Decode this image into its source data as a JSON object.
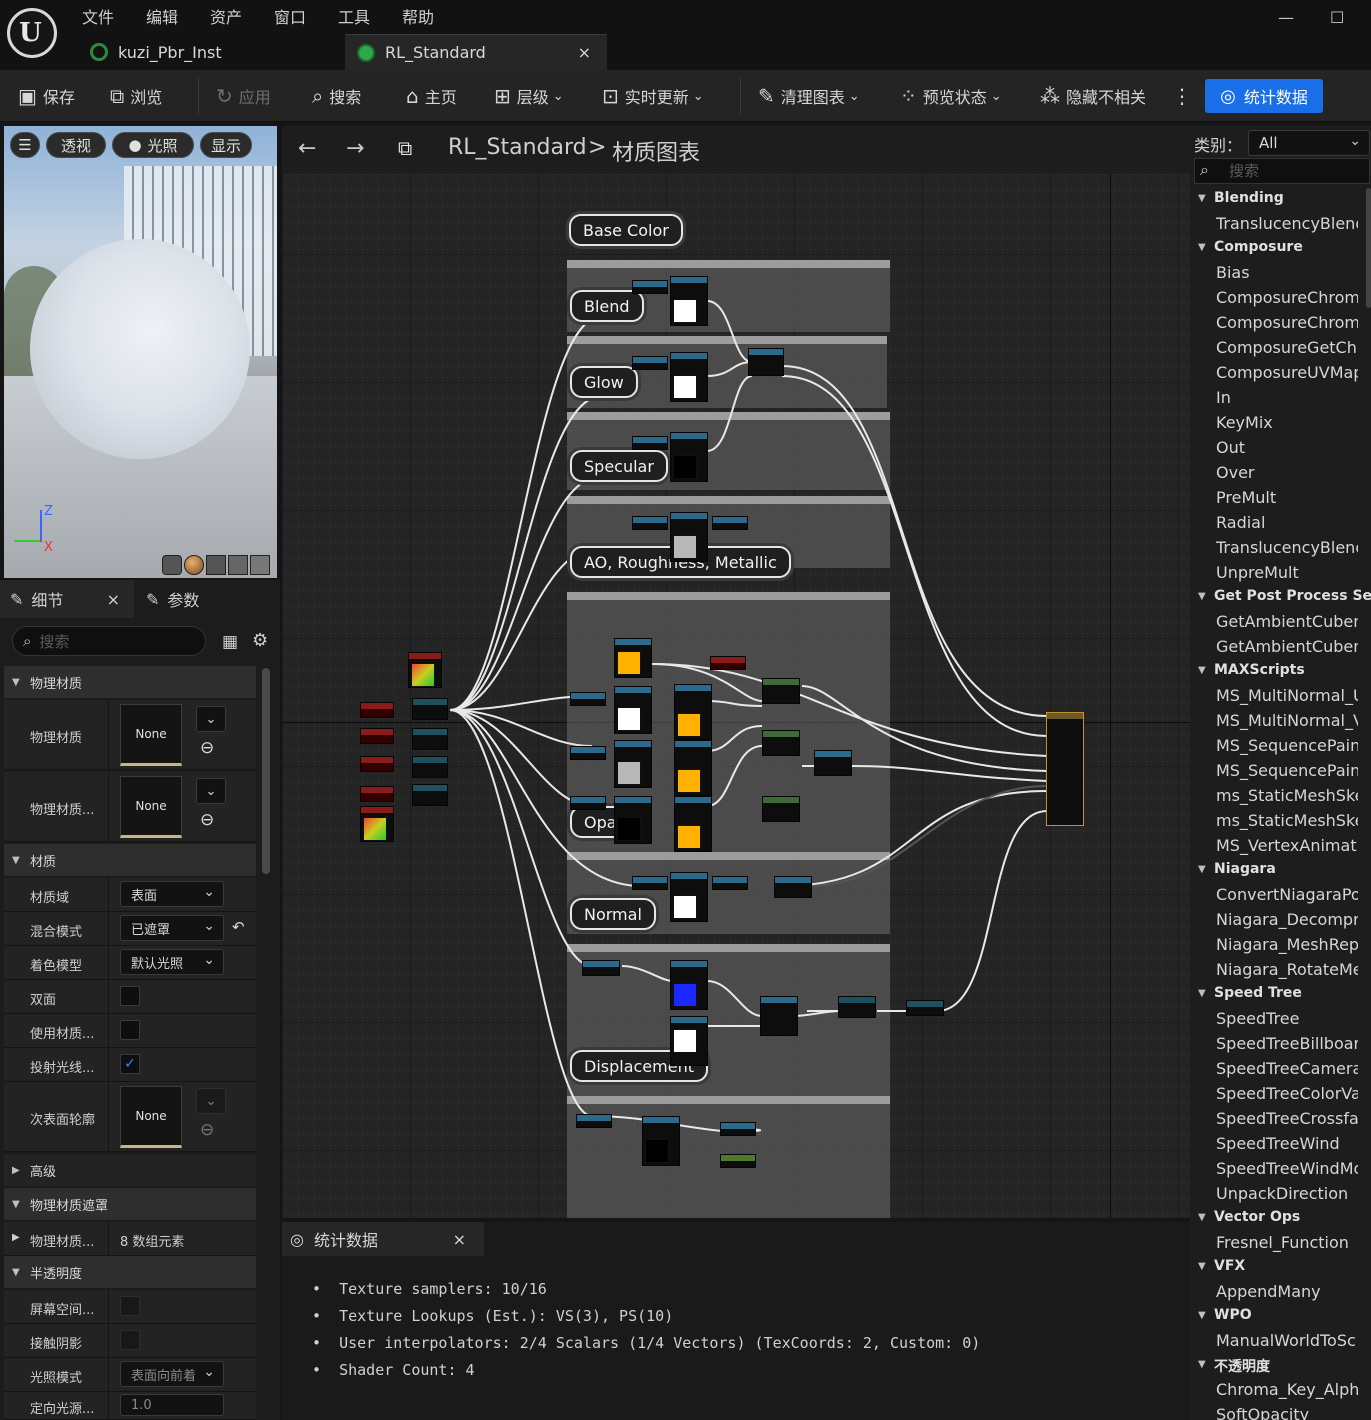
{
  "menu": [
    "文件",
    "编辑",
    "资产",
    "窗口",
    "工具",
    "帮助"
  ],
  "tabs": [
    {
      "label": "kuzi_Pbr_Inst",
      "close": ""
    },
    {
      "label": "RL_Standard",
      "close": "×"
    }
  ],
  "window": {
    "minimize": "—",
    "maximize": "☐"
  },
  "toolbar": {
    "save": "保存",
    "browse": "浏览",
    "apply": "应用",
    "search": "搜索",
    "home": "主页",
    "hierarchy": "层级",
    "live_update": "实时更新",
    "clean_graph": "清理图表",
    "preview_state": "预览状态",
    "hide_unrelated": "隐藏不相关",
    "stats": "统计数据"
  },
  "viewport": {
    "perspective": "透视",
    "lit": "光照",
    "show": "显示",
    "axis_z": "Z",
    "axis_x": "X"
  },
  "details": {
    "tab_details": "细节",
    "tab_params": "参数",
    "search_placeholder": "搜索",
    "sections": {
      "physmat": "物理材质",
      "material": "材质",
      "advanced": "高级",
      "physmask": "物理材质遮罩",
      "translucency": "半透明度"
    },
    "rows": {
      "physmat1": "物理材质",
      "physmat2": "物理材质...",
      "none": "None",
      "domain": "材质域",
      "domain_val": "表面",
      "blend": "混合模式",
      "blend_val": "已遮罩",
      "shading": "着色模型",
      "shading_val": "默认光照",
      "twosided": "双面",
      "usemat": "使用材质...",
      "castshadow": "投射光线...",
      "subsurface": "次表面轮廓",
      "physmask_row": "物理材质...",
      "physmask_val": "8 数组元素",
      "screenspace": "屏幕空间...",
      "contactshadow": "接触阴影",
      "lightmode": "光照模式",
      "lightmode_val": "表面向前着",
      "dirlight": "定向光源...",
      "dirlight_val": "1.0"
    }
  },
  "graph": {
    "breadcrumb_root": "RL_Standard",
    "breadcrumb_sep": ">",
    "breadcrumb_leaf": "材质图表",
    "labels": {
      "base_color": "Base Color",
      "blend": "Blend",
      "glow": "Glow",
      "specular": "Specular",
      "ao": "AO, Roughness, Metallic",
      "opacity": "Opa",
      "normal": "Normal",
      "displacement": "Displacement"
    },
    "comment_titles": {
      "c1": "Base Color",
      "c2": "Blend",
      "c3": "Glow",
      "c4": "Specular",
      "c5": "AO, Roughness, Metallic",
      "c6": "Opacity",
      "c7": "Normal",
      "c8": "Displacement"
    }
  },
  "stats": {
    "tab": "统计数据",
    "close": "×",
    "lines": [
      "Texture samplers: 10/16",
      "Texture Lookups (Est.): VS(3), PS(10)",
      "User interpolators: 2/4 Scalars (1/4 Vectors) (TexCoords: 2, Custom: 0)",
      "Shader Count: 4"
    ]
  },
  "palette": {
    "category_label": "类别：",
    "category_value": "All",
    "search_placeholder": "搜索",
    "entries": [
      {
        "t": "cat",
        "v": "Blending"
      },
      {
        "t": "item",
        "v": "TranslucencyBlend"
      },
      {
        "t": "cat",
        "v": "Composure"
      },
      {
        "t": "item",
        "v": "Bias"
      },
      {
        "t": "item",
        "v": "ComposureChroma"
      },
      {
        "t": "item",
        "v": "ComposureChroma"
      },
      {
        "t": "item",
        "v": "ComposureGetChi"
      },
      {
        "t": "item",
        "v": "ComposureUVMap"
      },
      {
        "t": "item",
        "v": "In"
      },
      {
        "t": "item",
        "v": "KeyMix"
      },
      {
        "t": "item",
        "v": "Out"
      },
      {
        "t": "item",
        "v": "Over"
      },
      {
        "t": "item",
        "v": "PreMult"
      },
      {
        "t": "item",
        "v": "Radial"
      },
      {
        "t": "item",
        "v": "TranslucencyBlend"
      },
      {
        "t": "item",
        "v": "UnpreMult"
      },
      {
        "t": "cat",
        "v": "Get Post Process Settings"
      },
      {
        "t": "item",
        "v": "GetAmbientCubem"
      },
      {
        "t": "item",
        "v": "GetAmbientCubem"
      },
      {
        "t": "cat",
        "v": "MAXScripts"
      },
      {
        "t": "item",
        "v": "MS_MultiNormal_U"
      },
      {
        "t": "item",
        "v": "MS_MultiNormal_V"
      },
      {
        "t": "item",
        "v": "MS_SequencePain"
      },
      {
        "t": "item",
        "v": "MS_SequencePain"
      },
      {
        "t": "item",
        "v": "ms_StaticMeshSke"
      },
      {
        "t": "item",
        "v": "ms_StaticMeshSke"
      },
      {
        "t": "item",
        "v": "MS_VertexAnimati"
      },
      {
        "t": "cat",
        "v": "Niagara"
      },
      {
        "t": "item",
        "v": "ConvertNiagaraPo"
      },
      {
        "t": "item",
        "v": "Niagara_Decompre"
      },
      {
        "t": "item",
        "v": "Niagara_MeshRep"
      },
      {
        "t": "item",
        "v": "Niagara_RotateMe"
      },
      {
        "t": "cat",
        "v": "Speed Tree"
      },
      {
        "t": "item",
        "v": "SpeedTree"
      },
      {
        "t": "item",
        "v": "SpeedTreeBillboar"
      },
      {
        "t": "item",
        "v": "SpeedTreeCamera"
      },
      {
        "t": "item",
        "v": "SpeedTreeColorVa"
      },
      {
        "t": "item",
        "v": "SpeedTreeCrossfa"
      },
      {
        "t": "item",
        "v": "SpeedTreeWind"
      },
      {
        "t": "item",
        "v": "SpeedTreeWindMo"
      },
      {
        "t": "item",
        "v": "UnpackDirection"
      },
      {
        "t": "cat",
        "v": "Vector Ops"
      },
      {
        "t": "item",
        "v": "Fresnel_Function"
      },
      {
        "t": "cat",
        "v": "VFX"
      },
      {
        "t": "item",
        "v": "AppendMany"
      },
      {
        "t": "cat",
        "v": "WPO"
      },
      {
        "t": "item",
        "v": "ManualWorldToSc"
      },
      {
        "t": "cat",
        "v": "不透明度"
      },
      {
        "t": "item",
        "v": "Chroma_Key_Alpha"
      },
      {
        "t": "item",
        "v": "SoftOpacity"
      }
    ]
  },
  "colors": {
    "accent": "#1a6fe8",
    "background": "#151515",
    "graph_bg": "#242424"
  }
}
